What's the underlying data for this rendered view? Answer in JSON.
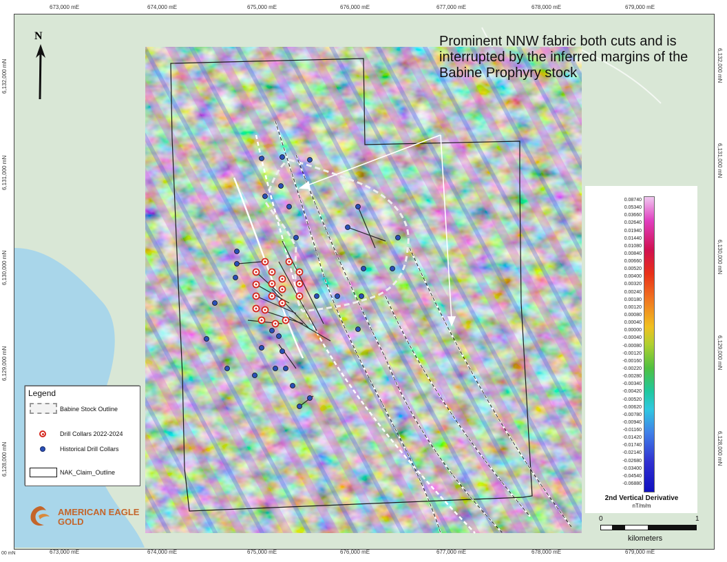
{
  "map": {
    "annotation": "Prominent NNW fabric both cuts and is interrupted by the inferred margins of the Babine Prophyry stock",
    "easting_labels": [
      "673,000 mE",
      "674,000 mE",
      "675,000 mE",
      "676,000 mE",
      "677,000 mE",
      "678,000 mE",
      "679,000 mE"
    ],
    "northing_labels": [
      "6,132,000 mN",
      "6,131,000 mN",
      "6,130,000 mN",
      "6,129,000 mN",
      "6,128,000 mN"
    ],
    "corner_label": "00 mN",
    "north_label": "N"
  },
  "legend": {
    "title": "Legend",
    "items": [
      {
        "label": "Babine Stock Outline"
      },
      {
        "label": "Drill Collars 2022-2024"
      },
      {
        "label": "Historical Drill Collars"
      },
      {
        "label": "NAK_Claim_Outline"
      }
    ]
  },
  "colorbar": {
    "title": "2nd Vertical Derivative",
    "unit": "nT/m/m",
    "ticks": [
      "0.08740",
      "0.05340",
      "0.03660",
      "0.02640",
      "0.01940",
      "0.01440",
      "0.01080",
      "0.00840",
      "0.00660",
      "0.00520",
      "0.00400",
      "0.00320",
      "0.00240",
      "0.00180",
      "0.00120",
      "0.00080",
      "0.00040",
      "0.00000",
      "-0.00040",
      "-0.00080",
      "-0.00120",
      "-0.00160",
      "-0.00220",
      "-0.00280",
      "-0.00340",
      "-0.00420",
      "-0.00520",
      "-0.00620",
      "-0.00780",
      "-0.00940",
      "-0.01160",
      "-0.01420",
      "-0.01740",
      "-0.02140",
      "-0.02680",
      "-0.03400",
      "-0.04540",
      "-0.06880"
    ]
  },
  "scalebar": {
    "labels": [
      "0",
      "1"
    ],
    "unit": "kilometers"
  },
  "logo": {
    "line1": "AMERICAN EAGLE",
    "line2": "GOLD"
  },
  "colors": {
    "lake": "#a9d6ea",
    "terrain": "#d9e7d6",
    "drill_new": "#d4261c",
    "drill_historic": "#2a4fb7",
    "logo": "#c4652a"
  }
}
